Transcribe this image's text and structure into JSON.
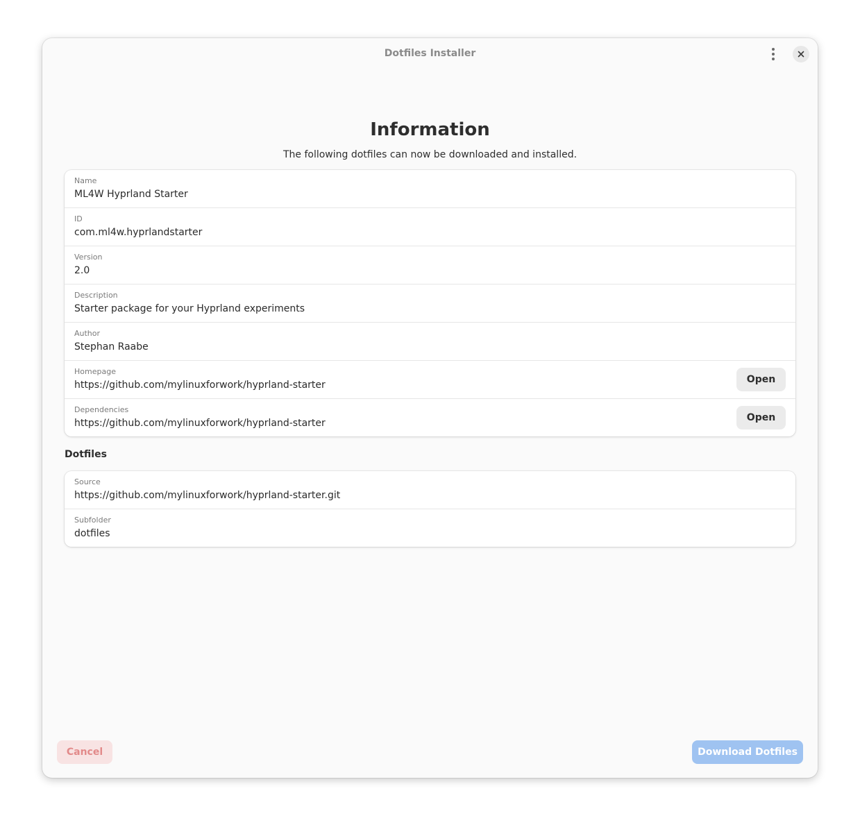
{
  "window": {
    "title": "Dotfiles Installer"
  },
  "header": {
    "heading": "Information",
    "subheading": "The following dotfiles can now be downloaded and installed."
  },
  "info": {
    "rows": [
      {
        "label": "Name",
        "value": "ML4W Hyprland Starter"
      },
      {
        "label": "ID",
        "value": "com.ml4w.hyprlandstarter"
      },
      {
        "label": "Version",
        "value": "2.0"
      },
      {
        "label": "Description",
        "value": "Starter package for your Hyprland experiments"
      },
      {
        "label": "Author",
        "value": "Stephan Raabe"
      },
      {
        "label": "Homepage",
        "value": "https://github.com/mylinuxforwork/hyprland-starter",
        "button": "Open"
      },
      {
        "label": "Dependencies",
        "value": "https://github.com/mylinuxforwork/hyprland-starter",
        "button": "Open"
      }
    ]
  },
  "dotfiles": {
    "section_title": "Dotfiles",
    "rows": [
      {
        "label": "Source",
        "value": "https://github.com/mylinuxforwork/hyprland-starter.git"
      },
      {
        "label": "Subfolder",
        "value": "dotfiles"
      }
    ]
  },
  "footer": {
    "cancel_label": "Cancel",
    "download_label": "Download Dotfiles"
  },
  "icons": {
    "menu": "vertical-dots-icon",
    "close": "close-icon"
  },
  "colors": {
    "destructive_text": "#e28a8a",
    "destructive_bg": "#f8e3e3",
    "accent_bg": "#9fc3f1"
  }
}
